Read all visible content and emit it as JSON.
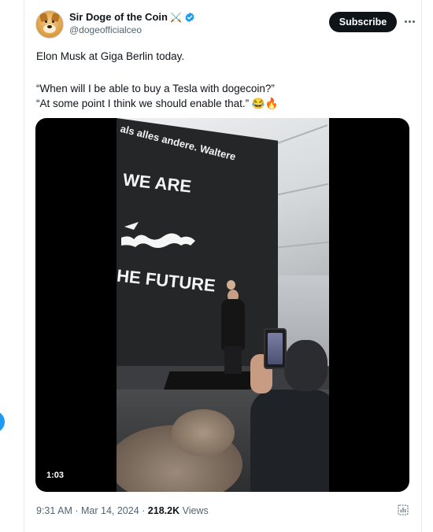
{
  "author": {
    "name": "Sir Doge of the Coin",
    "name_emoji": "⚔️",
    "handle": "@dogeofficialceo",
    "verified": true
  },
  "header": {
    "subscribe_label": "Subscribe"
  },
  "tweet": {
    "line1": "Elon Musk at Giga Berlin today.",
    "line2": "“When will I be able to buy a Tesla with dogecoin?”",
    "line3": "“At some point I think we should enable that.” 😂🔥"
  },
  "media": {
    "type": "video",
    "duration": "1:03",
    "screen_text_top": ", als alles andere. Waltere",
    "screen_text_we": "WE ARE",
    "screen_text_future": "HE FUTURE"
  },
  "meta": {
    "time": "9:31 AM",
    "date": "Mar 14, 2024",
    "views_count": "218.2K",
    "views_label": "Views"
  },
  "colors": {
    "accent": "#1d9bf0",
    "text": "#0f1419",
    "muted": "#536471"
  }
}
